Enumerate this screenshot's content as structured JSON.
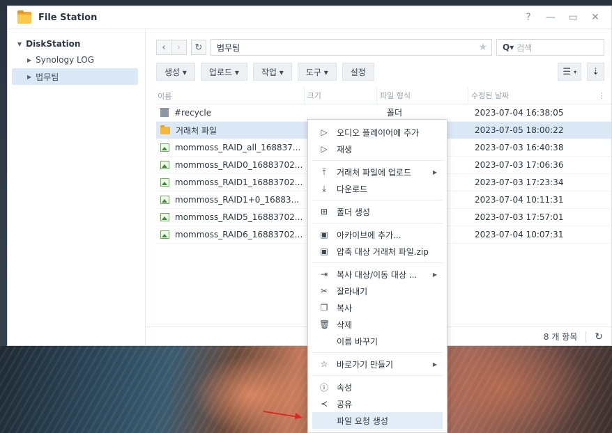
{
  "window": {
    "title": "File Station",
    "controls": [
      "?",
      "—",
      "▭",
      "✕"
    ]
  },
  "sidebar": {
    "root": "DiskStation",
    "items": [
      {
        "label": "Synology LOG",
        "selected": false
      },
      {
        "label": "법무팀",
        "selected": true
      }
    ]
  },
  "toolbar": {
    "path": "법무팀",
    "search_placeholder": "검색",
    "buttons": [
      "생성 ▾",
      "업로드 ▾",
      "작업 ▾",
      "도구 ▾",
      "설정"
    ]
  },
  "table": {
    "columns": [
      "이름",
      "크기",
      "파일 형식",
      "수정된 날짜"
    ],
    "rows": [
      {
        "icon": "recycle-bin-icon",
        "name": "#recycle",
        "size": "",
        "type": "폴더",
        "date": "2023-07-04 16:38:05",
        "selected": false
      },
      {
        "icon": "folder-icon",
        "name": "거래처 파일",
        "size": "",
        "type": "",
        "date": "2023-07-05 18:00:22",
        "selected": true
      },
      {
        "icon": "image-file-icon",
        "name": "mommoss_RAID_all_168837...",
        "size": "",
        "type": "",
        "date": "2023-07-03 16:40:38",
        "selected": false
      },
      {
        "icon": "image-file-icon",
        "name": "mommoss_RAID0_16883702...",
        "size": "",
        "type": "",
        "date": "2023-07-03 17:06:36",
        "selected": false
      },
      {
        "icon": "image-file-icon",
        "name": "mommoss_RAID1_16883702...",
        "size": "",
        "type": "",
        "date": "2023-07-03 17:23:34",
        "selected": false
      },
      {
        "icon": "image-file-icon",
        "name": "mommoss_RAID1+0_16883...",
        "size": "",
        "type": "",
        "date": "2023-07-04 10:11:31",
        "selected": false
      },
      {
        "icon": "image-file-icon",
        "name": "mommoss_RAID5_16883702...",
        "size": "",
        "type": "",
        "date": "2023-07-03 17:57:01",
        "selected": false
      },
      {
        "icon": "image-file-icon",
        "name": "mommoss_RAID6_16883702...",
        "size": "",
        "type": "",
        "date": "2023-07-04 10:07:31",
        "selected": false
      }
    ]
  },
  "status": {
    "count": "8 개 항목"
  },
  "context_menu": {
    "groups": [
      [
        {
          "icon": "play-icon",
          "glyph": "▷",
          "label": "오디오 플레이어에 추가"
        },
        {
          "icon": "play-icon",
          "glyph": "▷",
          "label": "재생"
        }
      ],
      [
        {
          "icon": "upload-icon",
          "glyph": "⤒",
          "label": "거래처 파일에 업로드",
          "submenu": true
        },
        {
          "icon": "download-icon",
          "glyph": "⤓",
          "label": "다운로드"
        }
      ],
      [
        {
          "icon": "new-folder-icon",
          "glyph": "⊞",
          "label": "폴더 생성"
        }
      ],
      [
        {
          "icon": "archive-icon",
          "glyph": "▣",
          "label": "아카이브에 추가..."
        },
        {
          "icon": "archive-icon",
          "glyph": "▣",
          "label": "압축 대상 거래처 파일.zip"
        }
      ],
      [
        {
          "icon": "copy-move-icon",
          "glyph": "⇥",
          "label": "복사 대상/이동 대상 ...",
          "submenu": true
        },
        {
          "icon": "cut-icon",
          "glyph": "✂",
          "label": "잘라내기"
        },
        {
          "icon": "copy-icon",
          "glyph": "❐",
          "label": "복사"
        },
        {
          "icon": "delete-icon",
          "glyph": "🗑",
          "label": "삭제"
        },
        {
          "icon": "",
          "glyph": "",
          "label": "이름 바꾸기"
        }
      ],
      [
        {
          "icon": "star-icon",
          "glyph": "☆",
          "label": "바로가기 만들기",
          "submenu": true
        }
      ],
      [
        {
          "icon": "info-icon",
          "glyph": "ⓘ",
          "label": "속성"
        },
        {
          "icon": "share-icon",
          "glyph": "≺",
          "label": "공유"
        },
        {
          "icon": "",
          "glyph": "",
          "label": "파일 요청 생성",
          "highlighted": true
        }
      ]
    ]
  }
}
